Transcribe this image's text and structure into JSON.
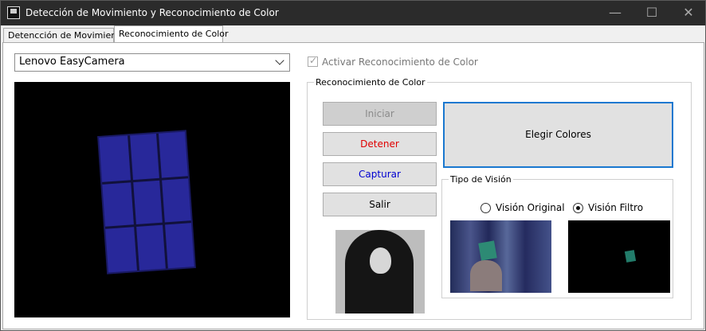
{
  "window": {
    "title": "Detección de Movimiento y Reconocimiento de Color",
    "minimize_icon": "—",
    "maximize_icon": "☐",
    "close_icon": "✕"
  },
  "tabs": [
    {
      "label": "Detencción de Movimiento"
    },
    {
      "label": "Reconocimiento de Color"
    }
  ],
  "camera": {
    "selected": "Lenovo EasyCamera"
  },
  "activate": {
    "label": "Activar Reconocimiento de Color"
  },
  "color_group": {
    "label": "Reconocimiento de Color",
    "buttons": {
      "start": "Iniciar",
      "stop": "Detener",
      "capture": "Capturar",
      "exit": "Salir",
      "choose_colors": "Elegir Colores"
    }
  },
  "vision": {
    "label": "Tipo de Visión",
    "original": "Visión Original",
    "filter": "Visión Filtro"
  },
  "colors": {
    "title_bar": "#2b2b2b",
    "stop": "#e00000",
    "capture": "#0000d0",
    "focus": "#1a78d0"
  }
}
